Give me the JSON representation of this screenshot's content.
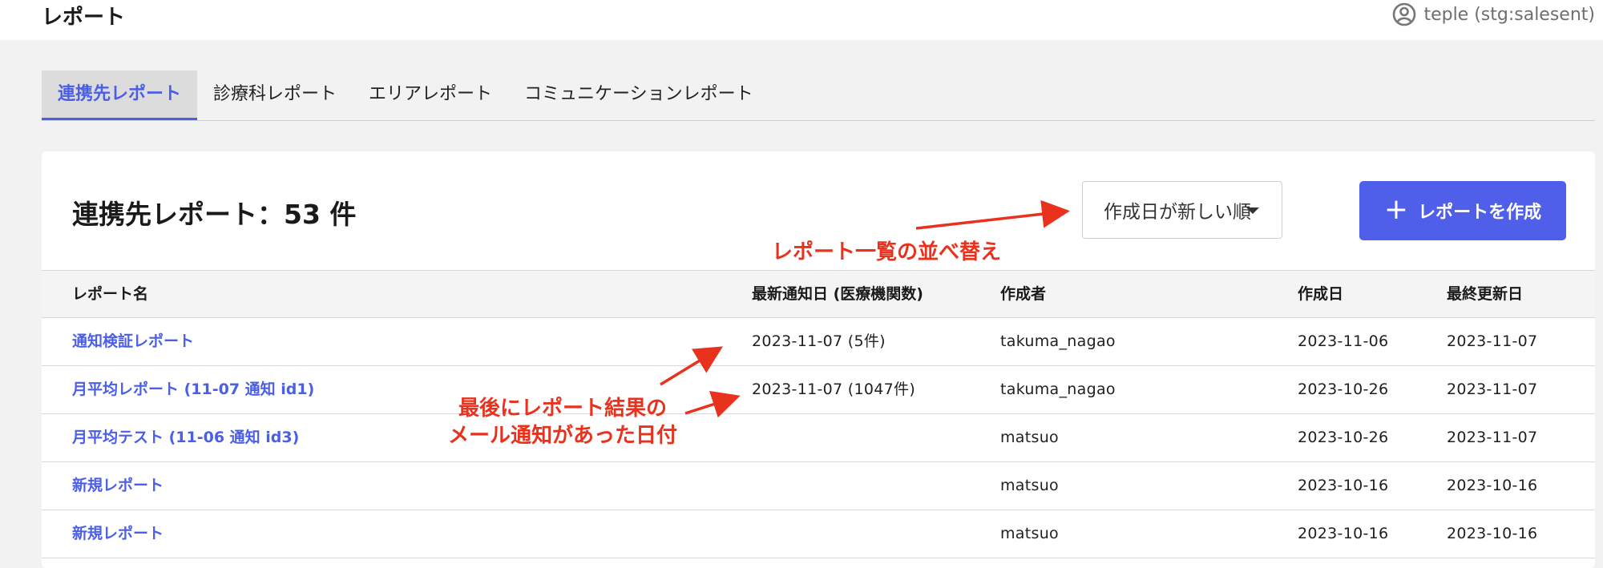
{
  "header": {
    "title": "レポート",
    "account_label": "teple (stg:salesent)"
  },
  "tabs": [
    {
      "label": "連携先レポート",
      "active": true
    },
    {
      "label": "診療科レポート",
      "active": false
    },
    {
      "label": "エリアレポート",
      "active": false
    },
    {
      "label": "コミュニケーションレポート",
      "active": false
    }
  ],
  "card": {
    "title": "連携先レポート：53 件",
    "sort_select_value": "作成日が新しい順",
    "create_button_label": "レポートを作成"
  },
  "table": {
    "headers": {
      "name": "レポート名",
      "notify": "最新通知日 (医療機関数)",
      "author": "作成者",
      "created": "作成日",
      "updated": "最終更新日"
    },
    "rows": [
      {
        "name": "通知検証レポート",
        "notify": "2023-11-07 (5件)",
        "author": "takuma_nagao",
        "created": "2023-11-06",
        "updated": "2023-11-07"
      },
      {
        "name": "月平均レポート (11-07 通知 id1)",
        "notify": "2023-11-07 (1047件)",
        "author": "takuma_nagao",
        "created": "2023-10-26",
        "updated": "2023-11-07"
      },
      {
        "name": "月平均テスト (11-06 通知 id3)",
        "notify": "",
        "author": "matsuo",
        "created": "2023-10-26",
        "updated": "2023-11-07"
      },
      {
        "name": "新規レポート",
        "notify": "",
        "author": "matsuo",
        "created": "2023-10-16",
        "updated": "2023-10-16"
      },
      {
        "name": "新規レポート",
        "notify": "",
        "author": "matsuo",
        "created": "2023-10-16",
        "updated": "2023-10-16"
      }
    ]
  },
  "annotations": {
    "sort_note": "レポート一覧の並べ替え",
    "notify_note_line1": "最後にレポート結果の",
    "notify_note_line2": "メール通知があった日付"
  },
  "colors": {
    "accent": "#4f5fe9",
    "link": "#4a5ee8",
    "annotation": "#e8321e",
    "background": "#f2f2f2"
  },
  "icons": {
    "account": "user-circle-icon",
    "dropdown": "caret-down-icon",
    "create": "plus-icon"
  }
}
